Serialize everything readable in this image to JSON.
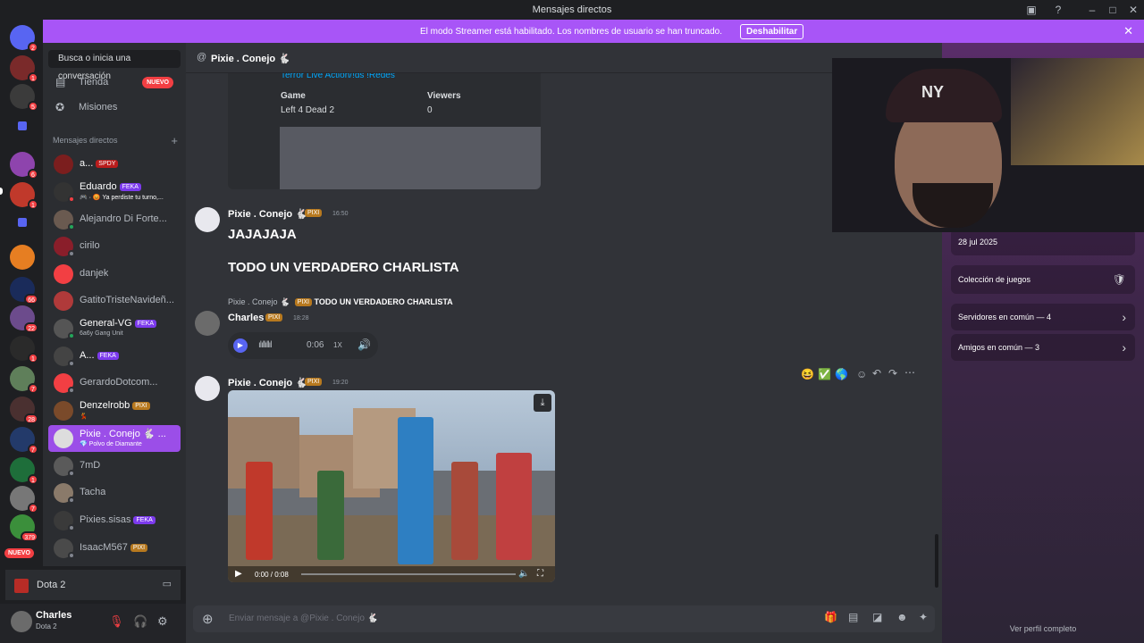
{
  "titlebar": {
    "title": "Mensajes directos"
  },
  "banner": {
    "message": "El modo Streamer está habilitado. Los nombres de usuario se han truncado.",
    "button": "Deshabilitar",
    "close": "✕"
  },
  "rail": {
    "badges": [
      "2",
      "1",
      "5",
      "6",
      "1",
      "66",
      "22",
      "1",
      "7",
      "28",
      "7",
      "1",
      "7",
      "379"
    ],
    "nuevo": "NUEVO"
  },
  "sidebar": {
    "search": "Busca o inicia una conversación",
    "tienda": "Tienda",
    "nuevo_badge": "NUEVO",
    "misiones": "Misiones",
    "dm_header": "Mensajes directos",
    "dms": [
      {
        "name": "a...",
        "tag": "SPDY",
        "sub": ""
      },
      {
        "name": "Eduardo",
        "tag": "FEKA",
        "sub": "🎮 · 😡 Ya perdiste tu turno,..."
      },
      {
        "name": "Alejandro Di Forte...",
        "tag": "",
        "sub": ""
      },
      {
        "name": "cirilo",
        "tag": "",
        "sub": ""
      },
      {
        "name": "danjek",
        "tag": "",
        "sub": ""
      },
      {
        "name": "GatitoTristeNavideñ...",
        "tag": "",
        "sub": ""
      },
      {
        "name": "General-VG",
        "tag": "FEKA",
        "sub": "6a6y Gang Unit"
      },
      {
        "name": "A...",
        "tag": "FEKA",
        "sub": ""
      },
      {
        "name": "GerardoDotcom...",
        "tag": "",
        "sub": ""
      },
      {
        "name": "Denzelrobb",
        "tag": "PIXI",
        "sub": "💃"
      },
      {
        "name": "Pixie . Conejo 🐇 ...",
        "tag": "",
        "sub": "💎 Polvo de Diamante"
      },
      {
        "name": "7mD",
        "tag": "",
        "sub": ""
      },
      {
        "name": "Tacha",
        "tag": "",
        "sub": ""
      },
      {
        "name": "Pixies.sisas",
        "tag": "FEKA",
        "sub": ""
      },
      {
        "name": "IsaacM567",
        "tag": "PIXI",
        "sub": ""
      }
    ],
    "game": "Dota 2"
  },
  "user": {
    "name": "Charles",
    "status": "Dota 2"
  },
  "chat": {
    "header": "Pixie . Conejo 🐇",
    "embed": {
      "title": "Terror Live Action/!ds !Redes",
      "game_label": "Game",
      "game_value": "Left 4 Dead 2",
      "viewers_label": "Viewers",
      "viewers_value": "0"
    },
    "messages": [
      {
        "author": "Pixie . Conejo 🐇",
        "tag": "PIXI",
        "time": "16:50",
        "lines": [
          "JAJAJAJA",
          "TODO UN VERDADERO CHARLISTA"
        ]
      },
      {
        "author": "Charles",
        "tag": "PIXI",
        "time": "18:28",
        "reply_author": "Pixie . Conejo 🐇",
        "reply_tag": "PIXI",
        "reply_text": "TODO UN VERDADERO CHARLISTA"
      },
      {
        "author": "Pixie . Conejo 🐇",
        "tag": "PIXI",
        "time": "19:20"
      }
    ],
    "voice": {
      "duration": "0:06",
      "speed": "1X"
    },
    "video": {
      "time": "0:00 / 0:08"
    },
    "input_placeholder": "Enviar mensaje a @Pixie . Conejo 🐇"
  },
  "profile": {
    "date": "28 jul 2025",
    "games": "Colección de juegos",
    "servers": "Servidores en común — 4",
    "friends": "Amigos en común — 3",
    "full": "Ver perfil completo"
  },
  "colors": {
    "accent": "#a855f7",
    "brand": "#5865f2",
    "danger": "#f23f43"
  }
}
